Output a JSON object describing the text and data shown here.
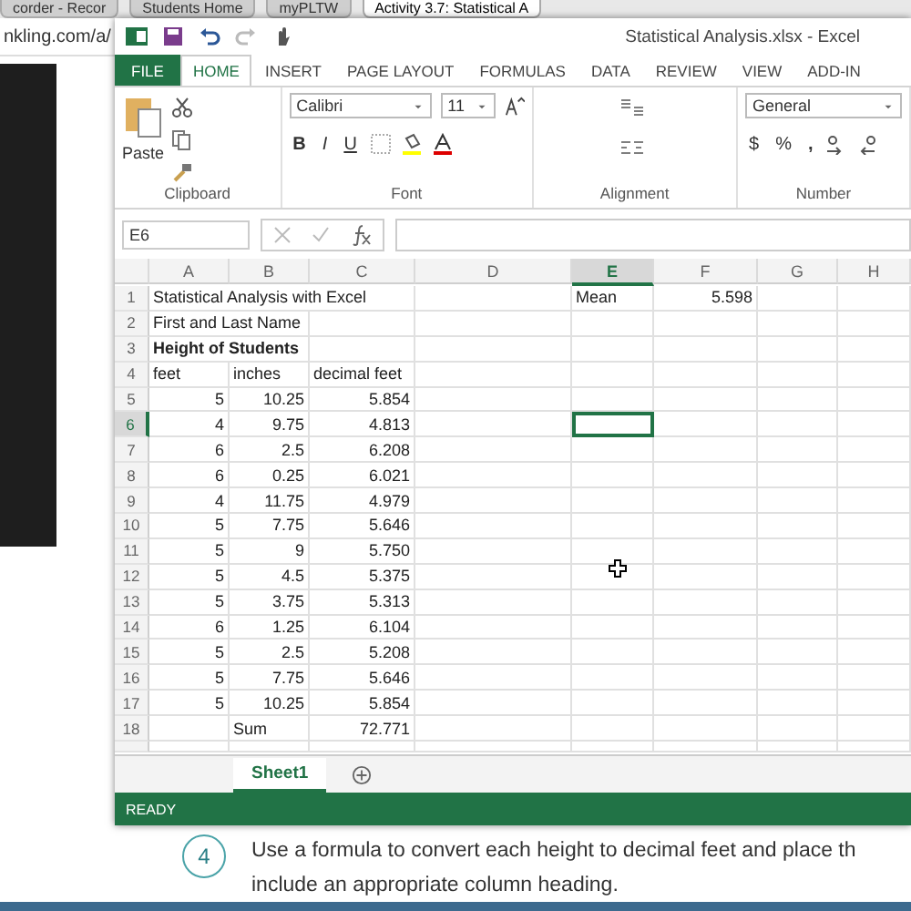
{
  "browser": {
    "tabs": [
      {
        "label": "corder - Recor",
        "selected": false
      },
      {
        "label": "Students Home",
        "selected": false
      },
      {
        "label": "myPLTW",
        "selected": false
      },
      {
        "label": "Activity 3.7: Statistical A",
        "selected": true
      }
    ],
    "address": "nkling.com/a/"
  },
  "excel": {
    "title": "Statistical Analysis.xlsx - Excel",
    "ribbon_tabs": [
      {
        "label": "FILE",
        "kind": "file",
        "selected": false
      },
      {
        "label": "HOME",
        "kind": "tab",
        "selected": true
      },
      {
        "label": "INSERT",
        "kind": "tab",
        "selected": false
      },
      {
        "label": "PAGE LAYOUT",
        "kind": "tab",
        "selected": false
      },
      {
        "label": "FORMULAS",
        "kind": "tab",
        "selected": false
      },
      {
        "label": "DATA",
        "kind": "tab",
        "selected": false
      },
      {
        "label": "REVIEW",
        "kind": "tab",
        "selected": false
      },
      {
        "label": "VIEW",
        "kind": "tab",
        "selected": false
      },
      {
        "label": "ADD-IN",
        "kind": "tab",
        "selected": false
      }
    ],
    "ribbon": {
      "paste": "Paste",
      "font_name": "Calibri",
      "font_size": "11",
      "bold": "B",
      "italic": "I",
      "underline": "U",
      "number_format": "General",
      "currency": "$",
      "percent": "%",
      "comma": ",",
      "groups": [
        "Clipboard",
        "Font",
        "Alignment",
        "Number"
      ]
    },
    "name_box": "E6",
    "columns": [
      {
        "label": "A",
        "selected": false
      },
      {
        "label": "B",
        "selected": false
      },
      {
        "label": "C",
        "selected": false
      },
      {
        "label": "D",
        "selected": false
      },
      {
        "label": "E",
        "selected": true
      },
      {
        "label": "F",
        "selected": false
      },
      {
        "label": "G",
        "selected": false
      },
      {
        "label": "H",
        "selected": false
      }
    ],
    "rows": [
      {
        "number": "1",
        "selected": false,
        "cells": [
          {
            "text": "Statistical Analysis with Excel",
            "kind": "text"
          },
          {
            "text": ""
          },
          {
            "text": ""
          },
          {
            "text": ""
          },
          {
            "text": "Mean",
            "kind": "text"
          },
          {
            "text": "5.598",
            "kind": "number"
          }
        ]
      },
      {
        "number": "2",
        "selected": false,
        "cells": [
          {
            "text": "First and Last Name",
            "kind": "text"
          }
        ]
      },
      {
        "number": "3",
        "selected": false,
        "cells": [
          {
            "text": "Height of Students",
            "kind": "text",
            "bold": true
          }
        ]
      },
      {
        "number": "4",
        "selected": false,
        "cells": [
          {
            "text": "feet",
            "kind": "text"
          },
          {
            "text": "inches",
            "kind": "text"
          },
          {
            "text": "decimal feet",
            "kind": "text"
          }
        ]
      },
      {
        "number": "5",
        "selected": false,
        "cells": [
          {
            "text": "5",
            "kind": "number"
          },
          {
            "text": "10.25",
            "kind": "number"
          },
          {
            "text": "5.854",
            "kind": "number"
          }
        ]
      },
      {
        "number": "6",
        "selected": true,
        "cells": [
          {
            "text": "4",
            "kind": "number"
          },
          {
            "text": "9.75",
            "kind": "number"
          },
          {
            "text": "4.813",
            "kind": "number"
          }
        ]
      },
      {
        "number": "7",
        "selected": false,
        "cells": [
          {
            "text": "6",
            "kind": "number"
          },
          {
            "text": "2.5",
            "kind": "number"
          },
          {
            "text": "6.208",
            "kind": "number"
          }
        ]
      },
      {
        "number": "8",
        "selected": false,
        "cells": [
          {
            "text": "6",
            "kind": "number"
          },
          {
            "text": "0.25",
            "kind": "number"
          },
          {
            "text": "6.021",
            "kind": "number"
          }
        ]
      },
      {
        "number": "9",
        "selected": false,
        "cells": [
          {
            "text": "4",
            "kind": "number"
          },
          {
            "text": "11.75",
            "kind": "number"
          },
          {
            "text": "4.979",
            "kind": "number"
          }
        ]
      },
      {
        "number": "10",
        "selected": false,
        "cells": [
          {
            "text": "5",
            "kind": "number"
          },
          {
            "text": "7.75",
            "kind": "number"
          },
          {
            "text": "5.646",
            "kind": "number"
          }
        ]
      },
      {
        "number": "11",
        "selected": false,
        "cells": [
          {
            "text": "5",
            "kind": "number"
          },
          {
            "text": "9",
            "kind": "number"
          },
          {
            "text": "5.750",
            "kind": "number"
          }
        ]
      },
      {
        "number": "12",
        "selected": false,
        "cells": [
          {
            "text": "5",
            "kind": "number"
          },
          {
            "text": "4.5",
            "kind": "number"
          },
          {
            "text": "5.375",
            "kind": "number"
          }
        ]
      },
      {
        "number": "13",
        "selected": false,
        "cells": [
          {
            "text": "5",
            "kind": "number"
          },
          {
            "text": "3.75",
            "kind": "number"
          },
          {
            "text": "5.313",
            "kind": "number"
          }
        ]
      },
      {
        "number": "14",
        "selected": false,
        "cells": [
          {
            "text": "6",
            "kind": "number"
          },
          {
            "text": "1.25",
            "kind": "number"
          },
          {
            "text": "6.104",
            "kind": "number"
          }
        ]
      },
      {
        "number": "15",
        "selected": false,
        "cells": [
          {
            "text": "5",
            "kind": "number"
          },
          {
            "text": "2.5",
            "kind": "number"
          },
          {
            "text": "5.208",
            "kind": "number"
          }
        ]
      },
      {
        "number": "16",
        "selected": false,
        "cells": [
          {
            "text": "5",
            "kind": "number"
          },
          {
            "text": "7.75",
            "kind": "number"
          },
          {
            "text": "5.646",
            "kind": "number"
          }
        ]
      },
      {
        "number": "17",
        "selected": false,
        "cells": [
          {
            "text": "5",
            "kind": "number"
          },
          {
            "text": "10.25",
            "kind": "number"
          },
          {
            "text": "5.854",
            "kind": "number"
          }
        ]
      },
      {
        "number": "18",
        "selected": false,
        "cells": [
          {
            "text": ""
          },
          {
            "text": "Sum",
            "kind": "text"
          },
          {
            "text": "72.771",
            "kind": "number"
          }
        ]
      }
    ],
    "sheets": [
      {
        "label": "Sheet1",
        "selected": true
      }
    ],
    "status": "READY"
  },
  "step": {
    "number": "4",
    "lines": [
      "Use a formula to convert each height to decimal feet and place th",
      "include an appropriate column heading."
    ]
  }
}
